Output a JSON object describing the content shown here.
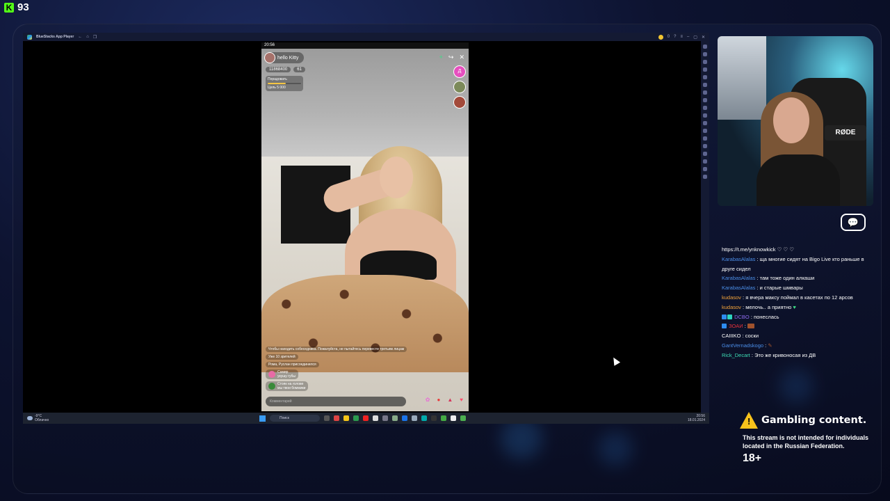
{
  "kick": {
    "viewer_count": "93"
  },
  "emulator": {
    "title": "BlueStacks App Player",
    "coins": "0"
  },
  "phone": {
    "status_time": "20:56",
    "host_name": "hello Kitty",
    "beans": "11868400",
    "viewers": "61",
    "rank_label": "Порадовать",
    "goal_label": "Цель",
    "goal_value": "5 000",
    "side_avatar_letter": "Д",
    "feed": [
      {
        "text": "Чтобы находить собеседника. Пожалуйста, не пытайтесь перевести третьим лицам"
      },
      {
        "text": "Уже 10 зрителей"
      },
      {
        "text": "Рома, Руслан присоединился"
      }
    ],
    "feed_users": [
      {
        "name": "Самир",
        "msg": "укушу губы"
      },
      {
        "name": "Стояк на голове",
        "msg": "мы твои бомжики"
      }
    ],
    "comment_placeholder": "Комментарий"
  },
  "taskbar": {
    "weather_temp": "-9°C",
    "weather_desc": "Облачно",
    "search_placeholder": "Поиск",
    "clock_time": "20:56",
    "clock_date": "18.01.2024"
  },
  "webcam": {
    "mic_label": "RØDE"
  },
  "chat": {
    "pinned": "https://t.me/ynknowkick ♡ ♡ ♡",
    "messages": [
      {
        "user": "KarabasAlalas",
        "color": "#4b8ee8",
        "msg": "ща многие сидят на Bigo Live кто раньше в друге сидел"
      },
      {
        "user": "KarabasAlalas",
        "color": "#4b8ee8",
        "msg": "там тоже один алкаши"
      },
      {
        "user": "KarabasAlalas",
        "color": "#4b8ee8",
        "msg": "и старые шмвары"
      },
      {
        "user": "kudasov",
        "color": "#f2a33a",
        "msg": "я вчера максу поймал в касетах по 12 арсов"
      },
      {
        "user": "kudasov",
        "color": "#f2a33a",
        "msg": "мелочь.. а приятно"
      },
      {
        "user": "DCBO",
        "color": "#8e6cf0",
        "msg": "понеслась"
      },
      {
        "user": "ЗОАИ",
        "color": "#e8323c",
        "msg": ""
      },
      {
        "user": "СAIIIKO",
        "color": "#ffffff",
        "msg": "соски"
      },
      {
        "user": "GantVernadskogo",
        "color": "#4b8ee8",
        "msg": ""
      },
      {
        "user": "Rick_Decart",
        "color": "#3ddcb4",
        "msg": "Это же кривоносая из ДВ"
      }
    ]
  },
  "warning": {
    "title": "Gambling content.",
    "text": "This stream is not intended for individuals located in the Russian Federation.",
    "age": "18+"
  }
}
